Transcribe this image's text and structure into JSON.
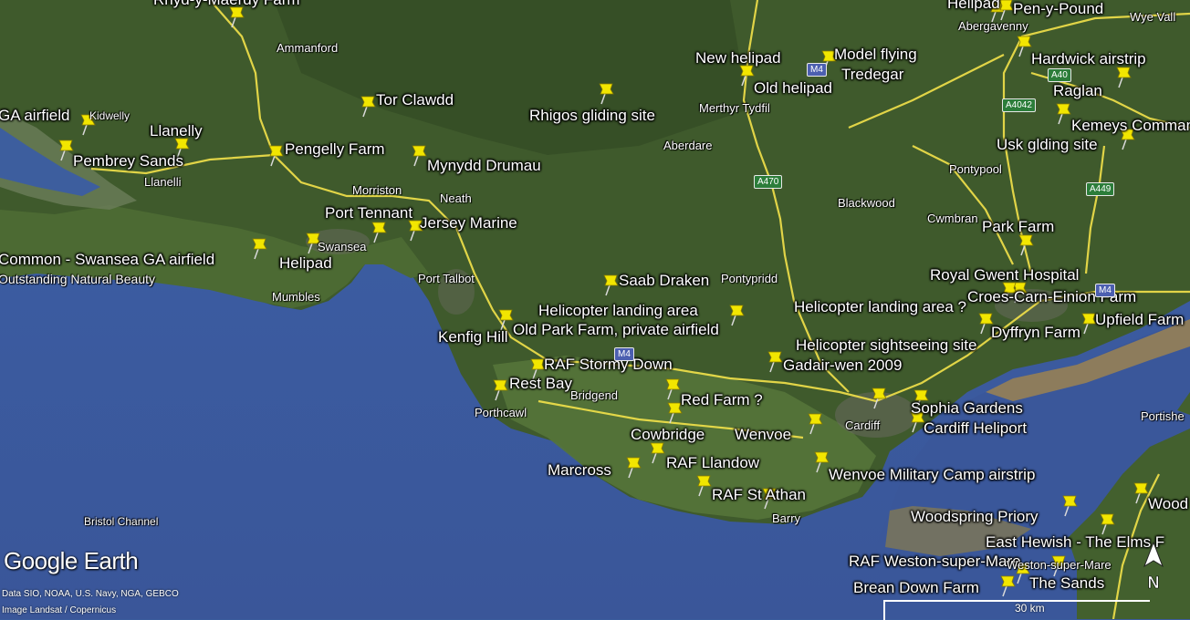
{
  "app": {
    "logo": "Google Earth"
  },
  "attribution": [
    "Data SIO, NOAA, U.S. Navy, NGA, GEBCO",
    "Image Landsat / Copernicus"
  ],
  "scale_label": "30 km",
  "compass_letter": "N",
  "colors": {
    "sea": "#3a5b9c",
    "land": "#3d5a2a",
    "roads": "#f3e24a",
    "pin": "#f2e600",
    "estuary": "#8b7b5b"
  },
  "placemarks": [
    "Rhyd-y-Maerdy Farm",
    "Helipad",
    "Pen-y-Pound",
    "New helipad",
    "Model flying",
    "Tredegar",
    "Hardwick airstrip",
    "Old helipad",
    "Raglan",
    "Tor Clawdd",
    "GA airfield",
    "Rhigos gliding site",
    "Kemeys Commander",
    "Llanelly",
    "Usk glding site",
    "Pengelly Farm",
    "Mynydd Drumau",
    "Pembrey Sands",
    "Port Tennant",
    "Jersey Marine",
    "Park Farm",
    "Common - Swansea GA airfield",
    "Helipad",
    "Royal Gwent Hospital",
    "Saab Draken",
    "Croes-Carn-Einion Farm",
    "Helicopter landing area",
    "Helicopter landing area ?",
    "Upfield Farm",
    "Old Park Farm, private airfield",
    "Dyffryn Farm",
    "Kenfig Hill",
    "Helicopter sightseeing site",
    "RAF Stormy Down",
    "Gadair-wen 2009",
    "Rest Bay",
    "Red Farm ?",
    "Sophia Gardens",
    "Cardiff Heliport",
    "Cowbridge",
    "Wenvoe",
    "RAF Llandow",
    "Marcross",
    "Wenvoe Military Camp airstrip",
    "RAF St Athan",
    "Woodspring Priory",
    "Wood",
    "East Hewish - The Elms F",
    "RAF Weston-super-Mare",
    "The Sands",
    "Brean Down Farm"
  ],
  "towns": [
    "Ammanford",
    "Abergavenny",
    "Wye Vall",
    "Kidwelly",
    "Merthyr Tydfil",
    "Llanelli",
    "Aberdare",
    "Pontypool",
    "Morriston",
    "Neath",
    "Blackwood",
    "Cwmbran",
    "Swansea",
    "Outstanding Natural Beauty",
    "Port Talbot",
    "Mumbles",
    "Pontypridd",
    "Bridgend",
    "Porthcawl",
    "Cardiff",
    "Barry",
    "Portishe",
    "Weston-super-Mare",
    "Bristol Channel"
  ],
  "roads": [
    "A40",
    "A4042",
    "A470",
    "A449",
    "M4",
    "M4",
    "M4"
  ]
}
